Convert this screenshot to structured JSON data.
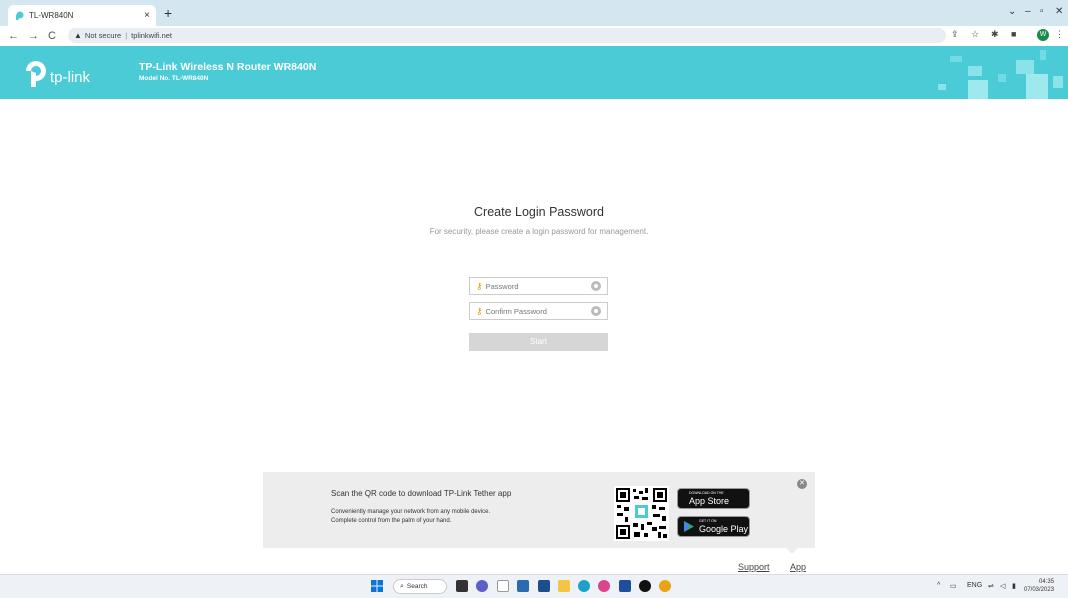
{
  "browser": {
    "tab_title": "TL-WR840N",
    "tab_close": "×",
    "new_tab": "+",
    "security_label": "Not secure",
    "url": "tplinkwifi.net",
    "profile_initial": "W"
  },
  "router": {
    "logo_text": "tp-link",
    "title": "TP-Link Wireless N Router WR840N",
    "model": "Model No. TL-WR840N"
  },
  "login": {
    "title": "Create Login Password",
    "subtitle": "For security, please create a login password for management.",
    "password_placeholder": "Password",
    "confirm_placeholder": "Confirm Password",
    "start_label": "Start"
  },
  "app_panel": {
    "title": "Scan the QR code to download TP-Link Tether app",
    "desc_line1": "Conveniently manage your network from any mobile device.",
    "desc_line2": "Complete control from the palm of your hand.",
    "app_store_small": "DOWNLOAD ON THE",
    "app_store_big": "App Store",
    "google_play_small": "GET IT ON",
    "google_play_big": "Google Play"
  },
  "footer": {
    "support": "Support",
    "app": "App"
  },
  "taskbar": {
    "search_label": "Search",
    "lang": "ENG",
    "time": "04:35",
    "date": "07/03/2023"
  },
  "colors": {
    "header_teal": "#4acbd6",
    "key_orange": "#e3a20b",
    "start_disabled": "#d6d6d6"
  }
}
